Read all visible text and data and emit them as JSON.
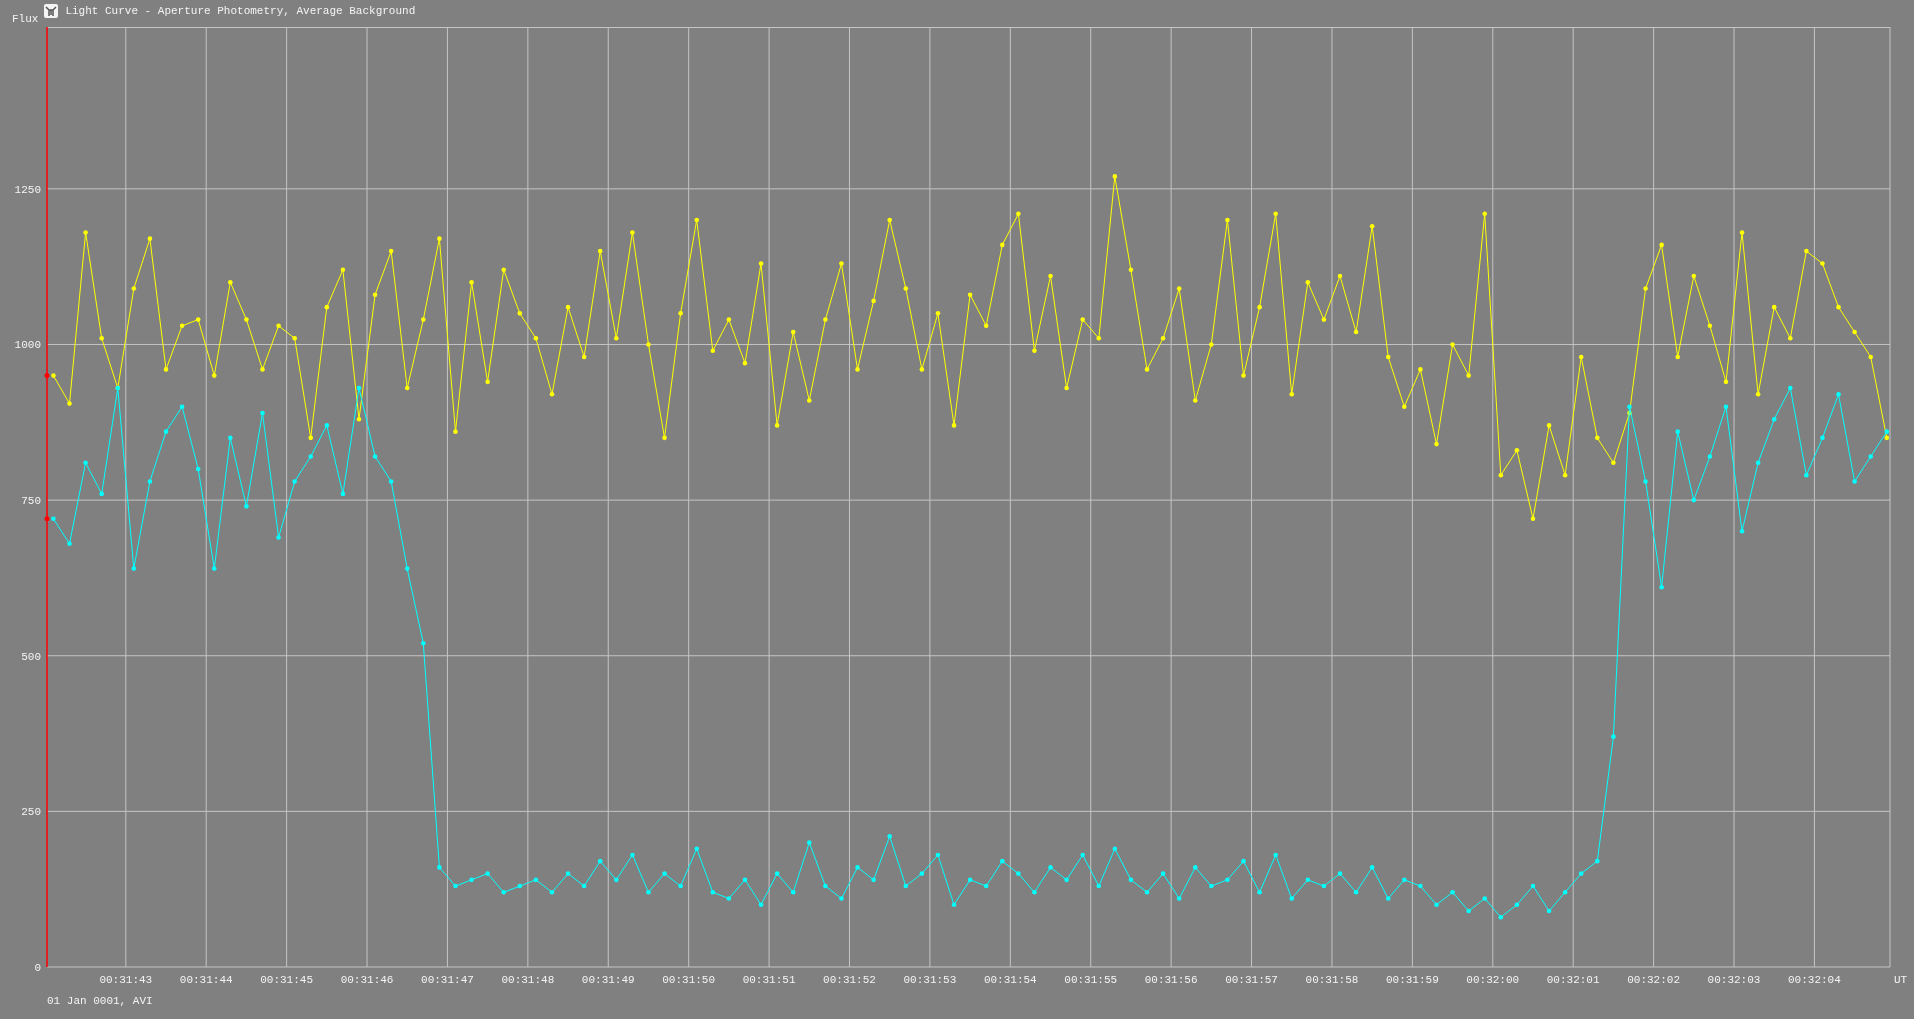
{
  "window": {
    "title": "Light Curve - Aperture Photometry, Average Background"
  },
  "chart": {
    "chart_data": {
      "type": "line",
      "grid": true,
      "ylabel": "Flux",
      "xlabel": "UT",
      "xlim": [
        1902.02,
        1924.94
      ],
      "ylim": [
        0,
        1510
      ],
      "yticks": [
        0,
        250,
        500,
        750,
        1000,
        1250
      ],
      "xticks": [
        {
          "value": 1903,
          "label": "00:31:43"
        },
        {
          "value": 1904,
          "label": "00:31:44"
        },
        {
          "value": 1905,
          "label": "00:31:45"
        },
        {
          "value": 1906,
          "label": "00:31:46"
        },
        {
          "value": 1907,
          "label": "00:31:47"
        },
        {
          "value": 1908,
          "label": "00:31:48"
        },
        {
          "value": 1909,
          "label": "00:31:49"
        },
        {
          "value": 1910,
          "label": "00:31:50"
        },
        {
          "value": 1911,
          "label": "00:31:51"
        },
        {
          "value": 1912,
          "label": "00:31:52"
        },
        {
          "value": 1913,
          "label": "00:31:53"
        },
        {
          "value": 1914,
          "label": "00:31:54"
        },
        {
          "value": 1915,
          "label": "00:31:55"
        },
        {
          "value": 1916,
          "label": "00:31:56"
        },
        {
          "value": 1917,
          "label": "00:31:57"
        },
        {
          "value": 1918,
          "label": "00:31:58"
        },
        {
          "value": 1919,
          "label": "00:31:59"
        },
        {
          "value": 1920,
          "label": "00:32:00"
        },
        {
          "value": 1921,
          "label": "00:32:01"
        },
        {
          "value": 1922,
          "label": "00:32:02"
        },
        {
          "value": 1923,
          "label": "00:32:03"
        },
        {
          "value": 1924,
          "label": "00:32:04"
        }
      ],
      "x": [
        1902.1,
        1902.3,
        1902.5,
        1902.7,
        1902.9,
        1903.1,
        1903.3,
        1903.5,
        1903.7,
        1903.9,
        1904.1,
        1904.3,
        1904.5,
        1904.7,
        1904.9,
        1905.1,
        1905.3,
        1905.5,
        1905.7,
        1905.9,
        1906.1,
        1906.3,
        1906.5,
        1906.7,
        1906.9,
        1907.1,
        1907.3,
        1907.5,
        1907.7,
        1907.9,
        1908.1,
        1908.3,
        1908.5,
        1908.7,
        1908.9,
        1909.1,
        1909.3,
        1909.5,
        1909.7,
        1909.9,
        1910.1,
        1910.3,
        1910.5,
        1910.7,
        1910.9,
        1911.1,
        1911.3,
        1911.5,
        1911.7,
        1911.9,
        1912.1,
        1912.3,
        1912.5,
        1912.7,
        1912.9,
        1913.1,
        1913.3,
        1913.5,
        1913.7,
        1913.9,
        1914.1,
        1914.3,
        1914.5,
        1914.7,
        1914.9,
        1915.1,
        1915.3,
        1915.5,
        1915.7,
        1915.9,
        1916.1,
        1916.3,
        1916.5,
        1916.7,
        1916.9,
        1917.1,
        1917.3,
        1917.5,
        1917.7,
        1917.9,
        1918.1,
        1918.3,
        1918.5,
        1918.7,
        1918.9,
        1919.1,
        1919.3,
        1919.5,
        1919.7,
        1919.9,
        1920.1,
        1920.3,
        1920.5,
        1920.7,
        1920.9,
        1921.1,
        1921.3,
        1921.5,
        1921.7,
        1921.9,
        1922.1,
        1922.3,
        1922.5,
        1922.7,
        1922.9,
        1923.1,
        1923.3,
        1923.5,
        1923.7,
        1923.9,
        1924.1,
        1924.3,
        1924.5,
        1924.7,
        1924.9
      ],
      "series": [
        {
          "color": "#ffff00",
          "values": [
            950,
            905,
            1180,
            1010,
            930,
            1090,
            1170,
            960,
            1030,
            1040,
            950,
            1100,
            1040,
            960,
            1030,
            1010,
            850,
            1060,
            1120,
            880,
            1080,
            1150,
            930,
            1040,
            1170,
            860,
            1100,
            940,
            1120,
            1050,
            1010,
            920,
            1060,
            980,
            1150,
            1010,
            1180,
            1000,
            850,
            1050,
            1200,
            990,
            1040,
            970,
            1130,
            870,
            1020,
            910,
            1040,
            1130,
            960,
            1070,
            1200,
            1090,
            960,
            1050,
            870,
            1080,
            1030,
            1160,
            1210,
            990,
            1110,
            930,
            1040,
            1010,
            1270,
            1120,
            960,
            1010,
            1090,
            910,
            1000,
            1200,
            950,
            1060,
            1210,
            920,
            1100,
            1040,
            1110,
            1020,
            1190,
            980,
            900,
            960,
            840,
            1000,
            950,
            1210,
            790,
            830,
            720,
            870,
            790,
            980,
            850,
            810,
            890,
            1090,
            1160,
            980,
            1110,
            1030,
            940,
            1180,
            920,
            1060,
            1010,
            1150,
            1130,
            1060,
            1020,
            980,
            850
          ]
        },
        {
          "color": "#00ffff",
          "values": [
            720,
            680,
            810,
            760,
            930,
            640,
            780,
            860,
            900,
            800,
            640,
            850,
            740,
            890,
            690,
            780,
            820,
            870,
            760,
            930,
            820,
            780,
            640,
            520,
            160,
            130,
            140,
            150,
            120,
            130,
            140,
            120,
            150,
            130,
            170,
            140,
            180,
            120,
            150,
            130,
            190,
            120,
            110,
            140,
            100,
            150,
            120,
            200,
            130,
            110,
            160,
            140,
            210,
            130,
            150,
            180,
            100,
            140,
            130,
            170,
            150,
            120,
            160,
            140,
            180,
            130,
            190,
            140,
            120,
            150,
            110,
            160,
            130,
            140,
            170,
            120,
            180,
            110,
            140,
            130,
            150,
            120,
            160,
            110,
            140,
            130,
            100,
            120,
            90,
            110,
            80,
            100,
            130,
            90,
            120,
            150,
            170,
            370,
            900,
            780,
            610,
            860,
            750,
            820,
            900,
            700,
            810,
            880,
            930,
            790,
            850,
            920,
            780,
            820,
            860
          ]
        }
      ]
    },
    "footer_note": "01 Jan 0001, AVI"
  }
}
